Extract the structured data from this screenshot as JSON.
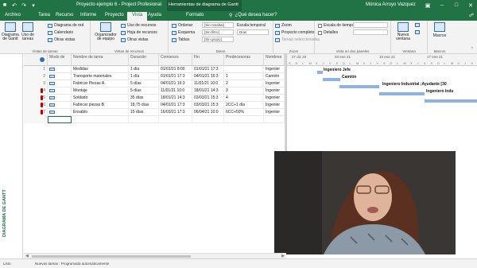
{
  "titlebar": {
    "doc_title": "Proyecto ejemplo 6 - Project Profesional",
    "tools_context": "Herramientas de diagrama de Gantt",
    "user": "Mónica Arroyo Vazquez"
  },
  "tabs": [
    "Archivo",
    "Tarea",
    "Recurso",
    "Informe",
    "Proyecto",
    "Vista",
    "Ayuda",
    "Formato"
  ],
  "tell_me": "¿Qué desea hacer?",
  "ribbon": {
    "gantt_btn": "Diagrama de Gantt",
    "uso_btn": "Uso de tareas",
    "task_views_items": [
      "Diagrama de red",
      "Calendario",
      "Otras vistas"
    ],
    "task_views_label": "Vistas de tareas",
    "organizer_btn": "Organizador de equipo",
    "resource_items": [
      "Uso de recursos",
      "Hoja de recursos",
      "Otras vistas"
    ],
    "resource_views_label": "Vistas de recursos",
    "data_items": [
      "Ordenar",
      "Esquema",
      "Tablas"
    ],
    "filter_inputs": [
      "[Sin resaltar]",
      "[Sin filtro]",
      "[Sin grupo]"
    ],
    "timescale_label": "Escala temporal",
    "timescale_value": "Días",
    "data_label": "Datos",
    "zoom_items": [
      "Zoom",
      "Proyecto completo",
      "Tareas seleccionadas"
    ],
    "zoom_label": "Zoom",
    "split_items": [
      "Escala de tiempo",
      "Detalles"
    ],
    "split_label": "Vista en dos paneles",
    "new_window": "Nueva ventana",
    "window_label": "Ventana",
    "macros": "Macros",
    "macros_label": "Macros"
  },
  "left_bar_label": "DIAGRAMA DE GANTT",
  "grid": {
    "headers": [
      "",
      "Modo de",
      "Nombre de tarea",
      "Duración",
      "Comienzo",
      "Fin",
      "Predecesoras",
      "Nombres"
    ],
    "rows": [
      {
        "n": "1",
        "name": "Medidas",
        "dur": "1 día",
        "start": "01/01/21 8:00",
        "end": "01/01/21 17:3",
        "pred": "",
        "res": "Ingenier"
      },
      {
        "n": "2",
        "name": "Transporte materiales",
        "dur": "1 día",
        "start": "01/01/21 17:3",
        "end": "04/01/21 16:3",
        "pred": "1",
        "res": "Camión"
      },
      {
        "n": "3",
        "name": "Fabricar Piezas A",
        "dur": "5 días",
        "start": "04/01/21 16:3",
        "end": "11/01/21 10:0",
        "pred": "2",
        "res": "Ingenier"
      },
      {
        "n": "4",
        "name": "Montaje",
        "dur": "5 días",
        "start": "11/01/21 10:0",
        "end": "18/01/21 14:3",
        "pred": "3",
        "res": "Ingenier"
      },
      {
        "n": "5",
        "name": "Soldado",
        "dur": "35 días",
        "start": "18/01/21 14:3",
        "end": "03/03/21 15:3",
        "pred": "4",
        "res": "Ingenier"
      },
      {
        "n": "6",
        "name": "Fabricar piezas B",
        "dur": "18,75 días",
        "start": "04/01/21 17:3",
        "end": "03/03/21 15:3",
        "pred": "2CC+1 día",
        "res": "Ingenier"
      },
      {
        "n": "7",
        "name": "Ensablo",
        "dur": "15 días",
        "start": "16/03/21 17:3",
        "end": "06/04/21 10:0",
        "pred": "6CC+50%",
        "res": "Ingenier"
      }
    ]
  },
  "gantt": {
    "months": [
      "27 dic 20",
      "03 ene 21",
      "10 ene 21",
      "17 ene 21"
    ],
    "day_letters": [
      "S",
      "D",
      "L",
      "M",
      "X",
      "J",
      "V",
      "S",
      "D",
      "L",
      "M",
      "X",
      "J",
      "V",
      "S",
      "D",
      "L",
      "M",
      "X",
      "J",
      "V",
      "S",
      "D",
      "L",
      "M",
      "X",
      "J",
      "V"
    ],
    "bar_labels": [
      "Ingeniero Jefe",
      "Camión",
      "Ingeniero Industrial ;Ayudante [30",
      "Ingeniero Indu"
    ]
  },
  "status": {
    "left": "Listo",
    "tasks_mode": "Nuevas tareas : Programada automáticamente"
  }
}
